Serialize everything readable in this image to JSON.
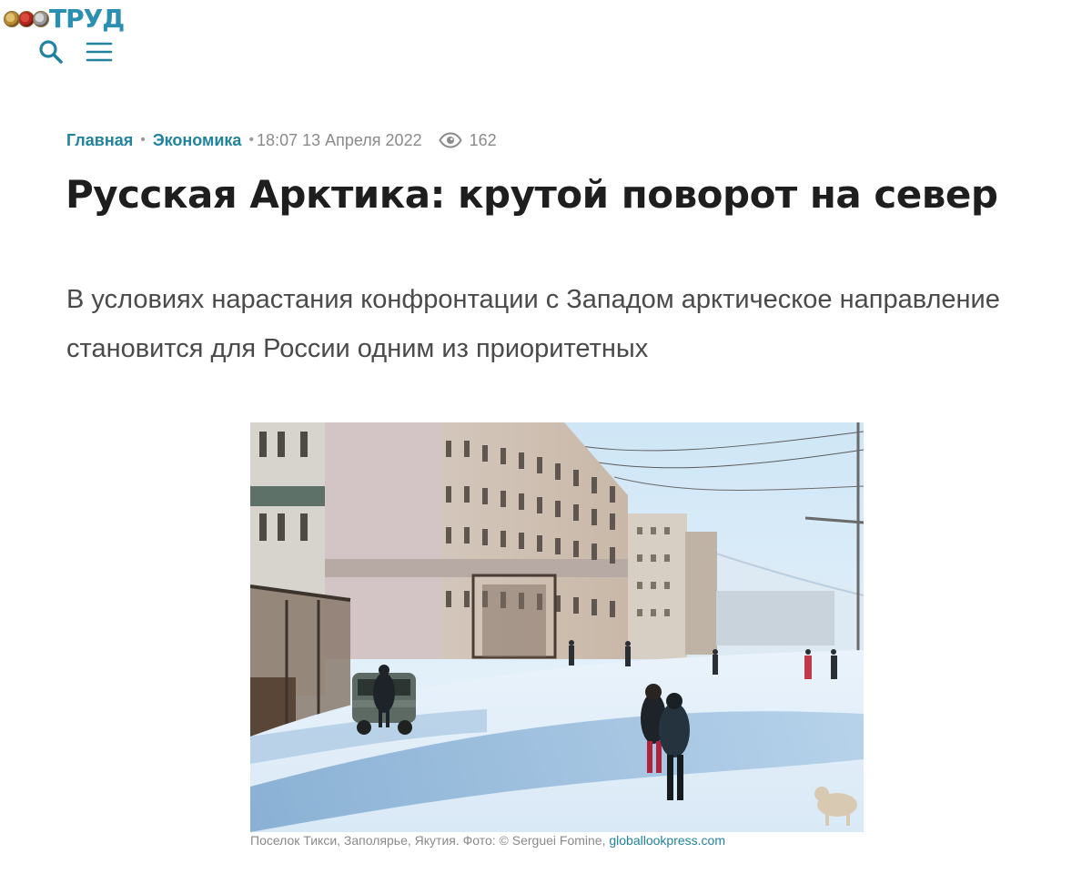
{
  "header": {
    "logo_text": "ТРУД",
    "search_icon": "search-icon",
    "menu_icon": "menu-icon"
  },
  "breadcrumb": {
    "home": "Главная",
    "section": "Экономика",
    "datetime": "18:07 13 Апреля 2022",
    "views": "162"
  },
  "article": {
    "title": "Русская Арктика: крутой поворот на север",
    "lead": "В условиях нарастания конфронтации с Западом арктическое направление становится для России одним из приоритетных",
    "image_caption": "Поселок Тикси, Заполярье, Якутия. Фото: © Serguei Fomine, ",
    "image_credit_link": "globallookpress.com"
  },
  "colors": {
    "accent": "#21839e",
    "logo": "#2a8fb0",
    "meta_gray": "#8a8a8a",
    "title": "#1e1e1e",
    "lead": "#4a4a4a"
  }
}
